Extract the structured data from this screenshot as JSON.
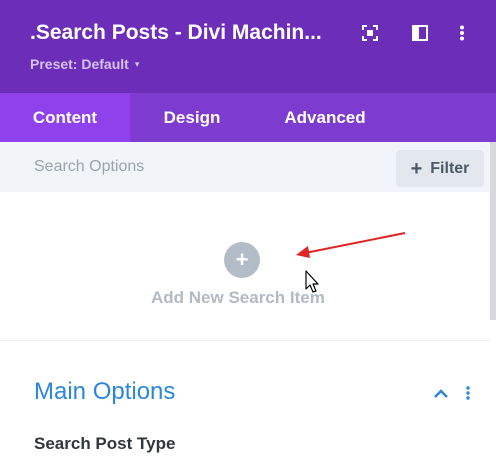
{
  "header": {
    "title": ".Search Posts - Divi Machin...",
    "preset_label": "Preset: Default",
    "preset_caret": "▾",
    "icons": [
      "expand-icon",
      "sidebar-toggle-icon",
      "more-vertical-icon"
    ]
  },
  "tabs": [
    {
      "label": "Content",
      "active": true
    },
    {
      "label": "Design",
      "active": false
    },
    {
      "label": "Advanced",
      "active": false
    }
  ],
  "filter_bar": {
    "placeholder": "Search Options",
    "button_icon": "+",
    "button_label": "Filter"
  },
  "add_item": {
    "icon": "+",
    "label": "Add New Search Item"
  },
  "main_options": {
    "title": "Main Options",
    "icons": [
      "chevron-up-icon",
      "more-vertical-icon"
    ],
    "field_label": "Search Post Type"
  },
  "colors": {
    "header_bg": "#6c2eb9",
    "tabs_bg": "#7e3bd0",
    "active_tab_bg": "#8f42ec",
    "accent_blue": "#2b87da",
    "annotation_arrow": "#e02424"
  }
}
